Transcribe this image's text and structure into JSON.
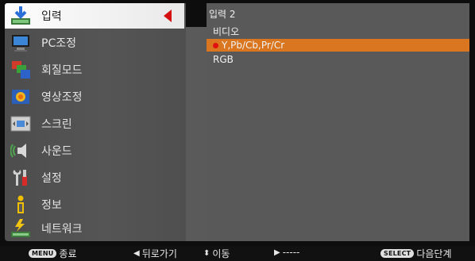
{
  "menu": {
    "items": [
      {
        "label": "입력",
        "icon": "input-icon"
      },
      {
        "label": "PC조정",
        "icon": "monitor-icon"
      },
      {
        "label": "회질모드",
        "icon": "picture-mode-icon"
      },
      {
        "label": "영상조정",
        "icon": "image-adjust-icon"
      },
      {
        "label": "스크린",
        "icon": "screen-icon"
      },
      {
        "label": "사운드",
        "icon": "speaker-icon"
      },
      {
        "label": "설정",
        "icon": "settings-icon"
      },
      {
        "label": "정보",
        "icon": "info-icon"
      },
      {
        "label": "네트워크",
        "icon": "network-icon"
      }
    ],
    "active_index": 0
  },
  "submenu": {
    "title": "입력 2",
    "items": [
      {
        "label": "비디오"
      },
      {
        "label": "Y,Pb/Cb,Pr/Cr"
      },
      {
        "label": "RGB"
      }
    ],
    "selected_index": 1
  },
  "status_bar": {
    "menu_key": "MENU",
    "menu_label": "종료",
    "back_glyph": "◀",
    "back_label": "뒤로가기",
    "move_glyph": "⬍",
    "move_label": "이동",
    "next_glyph": "▶",
    "next_label": "-----",
    "select_key": "SELECT",
    "select_label": "다음단계"
  },
  "colors": {
    "highlight": "#d9761f",
    "active_arrow": "#d51010",
    "selected_dot": "#e11010"
  }
}
